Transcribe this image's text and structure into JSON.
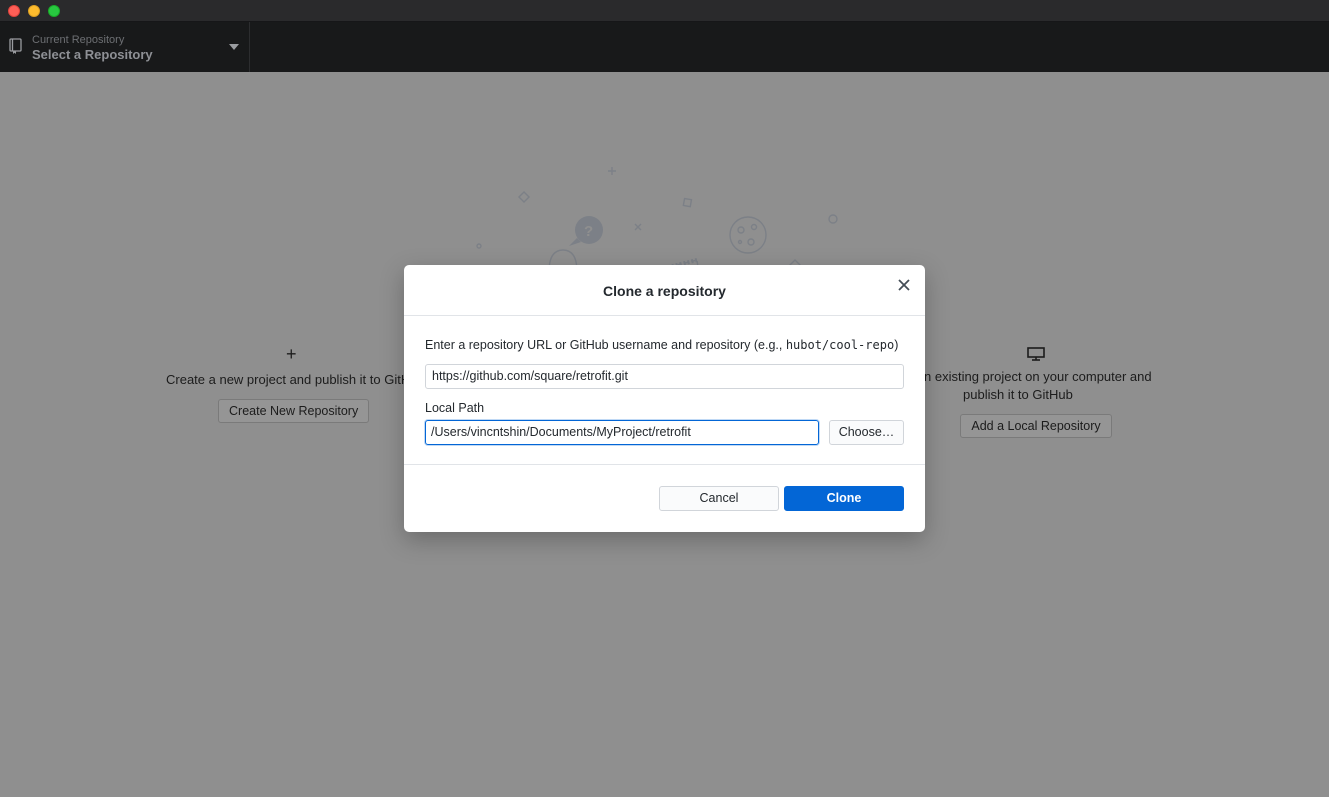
{
  "window": {
    "traffic_lights": [
      "close",
      "minimize",
      "maximize"
    ]
  },
  "toolbar": {
    "repo_caption": "Current Repository",
    "repo_value": "Select a Repository",
    "repo_icon": "repo-icon",
    "caret_icon": "chevron-down-icon"
  },
  "background": {
    "create_text": "Create a new project and publish it to GitH",
    "create_button": "Create New Repository",
    "create_icon": "+",
    "local_text_line1": "n existing project on your computer and",
    "local_text_line2": "publish it to GitHub",
    "local_button": "Add a Local Repository",
    "local_icon": "monitor-icon"
  },
  "dialog": {
    "title": "Clone a repository",
    "prompt": "Enter a repository URL or GitHub username and repository (e.g., ",
    "prompt_example": "hubot/cool-repo",
    "prompt_suffix": ")",
    "url_value": "https://github.com/square/retrofit.git",
    "local_path_label": "Local Path",
    "local_path_value": "/Users/vincntshin/Documents/MyProject/retrofit",
    "choose_label": "Choose…",
    "cancel_label": "Cancel",
    "clone_label": "Clone"
  },
  "colors": {
    "accent": "#0366d6",
    "overlay": "#8f8f8f",
    "toolbar": "#18191a"
  }
}
